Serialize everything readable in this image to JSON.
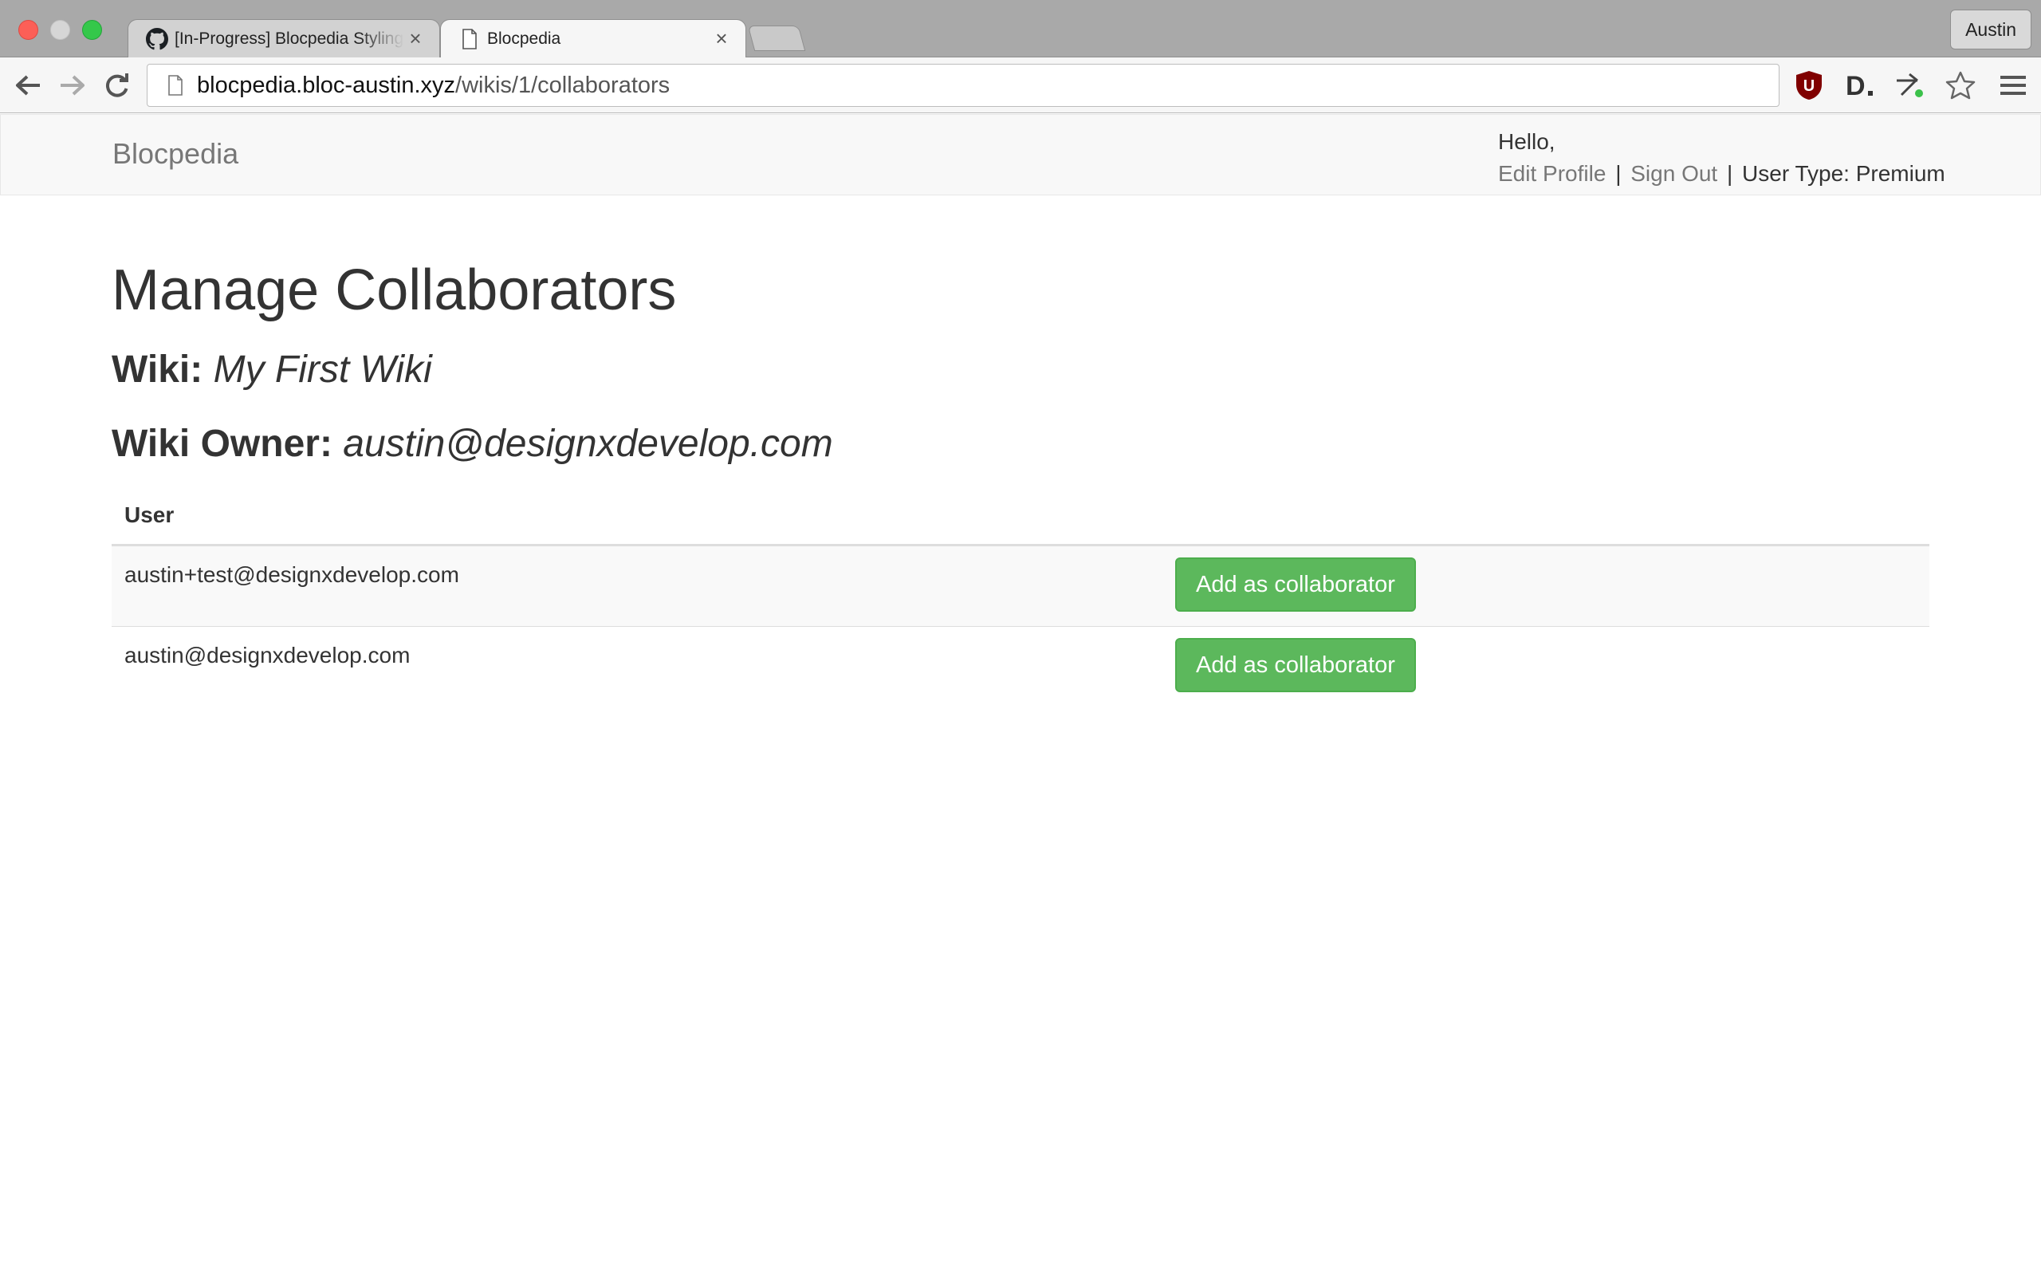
{
  "browser": {
    "tabs": [
      {
        "title": "[In-Progress] Blocpedia Styling",
        "icon": "github-icon"
      },
      {
        "title": "Blocpedia",
        "icon": "page-icon"
      }
    ],
    "profile_name": "Austin",
    "url_host": "blocpedia.bloc-austin.xyz",
    "url_path": "/wikis/1/collaborators",
    "extensions": [
      "ublock-icon",
      "d-extension-icon",
      "tool-extension-icon",
      "bookmark-star-icon",
      "menu-icon"
    ]
  },
  "navbar": {
    "brand": "Blocpedia",
    "greeting": "Hello,",
    "edit_profile": "Edit Profile",
    "separator": "|",
    "sign_out": "Sign Out",
    "user_type": "User Type: Premium"
  },
  "main": {
    "title": "Manage Collaborators",
    "wiki_label": "Wiki:",
    "wiki_name": "My First Wiki",
    "owner_label": "Wiki Owner:",
    "owner_email": "austin@designxdevelop.com",
    "table": {
      "columns": [
        "User",
        ""
      ],
      "rows": [
        {
          "email": "austin+test@designxdevelop.com",
          "action": "Add as collaborator"
        },
        {
          "email": "austin@designxdevelop.com",
          "action": "Add as collaborator"
        }
      ]
    }
  },
  "colors": {
    "button_green": "#5cb85c",
    "link_gray": "#777777",
    "navbar_bg": "#f8f8f8"
  }
}
